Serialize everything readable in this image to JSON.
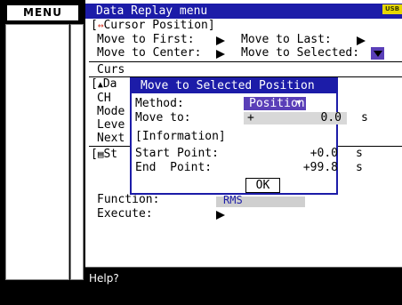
{
  "sidebar": {
    "menu_label": "MENU"
  },
  "header": {
    "title": "Data Replay menu",
    "badge": "USB"
  },
  "cursor_section": {
    "heading": "Cursor Position]",
    "move_first_label": "Move to First:",
    "move_last_label": "Move to Last:",
    "move_center_label": "Move to Center:",
    "move_selected_label": "Move to Selected:"
  },
  "background_rows": {
    "curs": "Curs",
    "data_prefix": "Da",
    "ch": "CH",
    "mode": "Mode",
    "level": "Leve",
    "next": "Next",
    "stat_prefix": "St",
    "function_label": "Function:",
    "function_value": "RMS",
    "execute_label": "Execute:"
  },
  "dialog": {
    "title": "Move to Selected Position",
    "method_label": "Method:",
    "method_value": "Position",
    "move_to_label": "Move to:",
    "move_to_sign": "+",
    "move_to_value": "0.0",
    "move_to_unit": "s",
    "info_heading": "[Information]",
    "start_label": "Start Point:",
    "start_value": "+0.0",
    "start_unit": "s",
    "end_label": "End  Point:",
    "end_value": "+99.8",
    "end_unit": "s",
    "ok_label": "OK"
  },
  "help": {
    "text": "Help?"
  },
  "colors": {
    "accent_blue": "#1c1ca8",
    "select_purple": "#5a3fb8",
    "usb_yellow": "#e6d700"
  }
}
